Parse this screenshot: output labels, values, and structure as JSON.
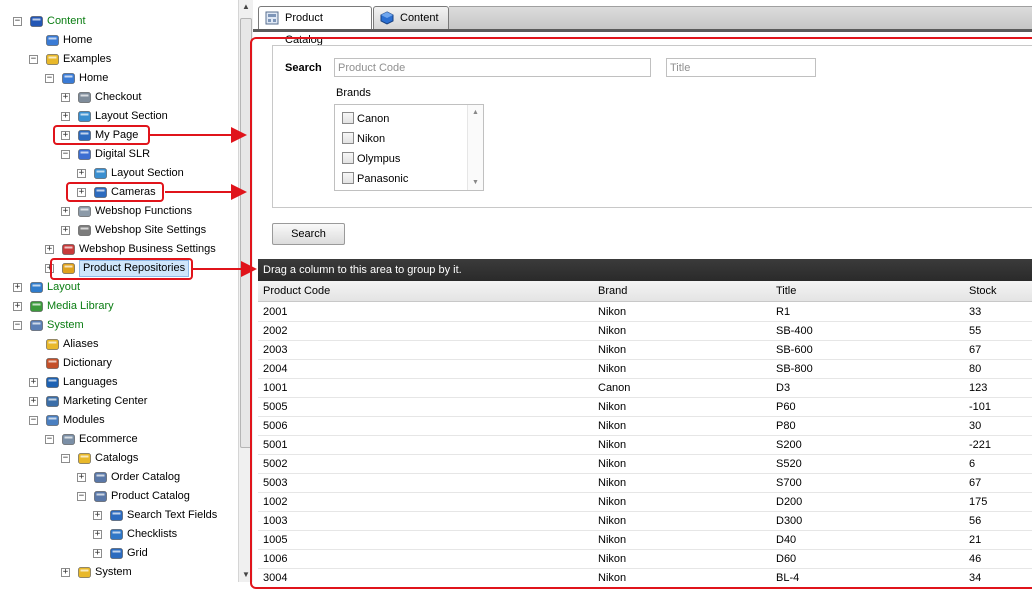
{
  "tree": {
    "nodes": [
      {
        "label": "Content",
        "icon": "content-icon",
        "expander": "minus",
        "color": "green"
      },
      {
        "label": "Home",
        "icon": "home-icon",
        "expander": ""
      },
      {
        "label": "Examples",
        "icon": "folder-icon",
        "expander": "minus"
      },
      {
        "label": "Home",
        "icon": "home-icon",
        "expander": "minus"
      },
      {
        "label": "Checkout",
        "icon": "page-icon",
        "expander": "plus"
      },
      {
        "label": "Layout Section",
        "icon": "layout-icon",
        "expander": "plus"
      },
      {
        "label": "My Page",
        "icon": "grid-icon",
        "expander": "plus"
      },
      {
        "label": "Digital SLR",
        "icon": "database-icon",
        "expander": "minus"
      },
      {
        "label": "Layout Section",
        "icon": "layout-icon",
        "expander": "plus"
      },
      {
        "label": "Cameras",
        "icon": "grid-icon",
        "expander": "plus"
      },
      {
        "label": "Webshop Functions",
        "icon": "document-icon",
        "expander": "plus"
      },
      {
        "label": "Webshop Site Settings",
        "icon": "settings-icon",
        "expander": "plus"
      },
      {
        "label": "Webshop Business Settings",
        "icon": "business-icon",
        "expander": "plus"
      },
      {
        "label": "Product Repositories",
        "icon": "box-icon",
        "expander": "plus"
      },
      {
        "label": "Layout",
        "icon": "layout-window-icon",
        "expander": "plus",
        "color": "green"
      },
      {
        "label": "Media Library",
        "icon": "image-icon",
        "expander": "plus",
        "color": "green"
      },
      {
        "label": "System",
        "icon": "system-icon",
        "expander": "minus",
        "color": "green"
      },
      {
        "label": "Aliases",
        "icon": "folder-icon",
        "expander": ""
      },
      {
        "label": "Dictionary",
        "icon": "dictionary-icon",
        "expander": ""
      },
      {
        "label": "Languages",
        "icon": "language-icon",
        "expander": "plus"
      },
      {
        "label": "Marketing Center",
        "icon": "marketing-icon",
        "expander": "plus"
      },
      {
        "label": "Modules",
        "icon": "modules-icon",
        "expander": "minus"
      },
      {
        "label": "Ecommerce",
        "icon": "ecommerce-icon",
        "expander": "minus"
      },
      {
        "label": "Catalogs",
        "icon": "folder-icon",
        "expander": "minus"
      },
      {
        "label": "Order Catalog",
        "icon": "catalog-icon",
        "expander": "plus"
      },
      {
        "label": "Product Catalog",
        "icon": "catalog-icon",
        "expander": "minus"
      },
      {
        "label": "Search Text Fields",
        "icon": "grid-icon",
        "expander": "plus"
      },
      {
        "label": "Checklists",
        "icon": "checklist-icon",
        "expander": "plus"
      },
      {
        "label": "Grid",
        "icon": "grid-icon",
        "expander": "plus"
      },
      {
        "label": "System",
        "icon": "folder-icon",
        "expander": "plus"
      }
    ]
  },
  "tabs": [
    {
      "label": "Product Catalog",
      "icon": "catalog-icon",
      "active": true
    },
    {
      "label": "Content",
      "icon": "cube-icon",
      "active": false
    }
  ],
  "search": {
    "label": "Search",
    "product_code_placeholder": "Product Code",
    "title_placeholder": "Title",
    "brands_label": "Brands",
    "brands": [
      "Canon",
      "Nikon",
      "Olympus",
      "Panasonic"
    ],
    "button_label": "Search"
  },
  "grid": {
    "group_hint": "Drag a column to this area to group by it.",
    "columns": [
      "Product Code",
      "Brand",
      "Title",
      "Stock"
    ],
    "rows": [
      [
        "2001",
        "Nikon",
        "R1",
        "33"
      ],
      [
        "2002",
        "Nikon",
        "SB-400",
        "55"
      ],
      [
        "2003",
        "Nikon",
        "SB-600",
        "67"
      ],
      [
        "2004",
        "Nikon",
        "SB-800",
        "80"
      ],
      [
        "1001",
        "Canon",
        "D3",
        "123"
      ],
      [
        "5005",
        "Nikon",
        "P60",
        "-101"
      ],
      [
        "5006",
        "Nikon",
        "P80",
        "30"
      ],
      [
        "5001",
        "Nikon",
        "S200",
        "-221"
      ],
      [
        "5002",
        "Nikon",
        "S520",
        "6"
      ],
      [
        "5003",
        "Nikon",
        "S700",
        "67"
      ],
      [
        "1002",
        "Nikon",
        "D200",
        "175"
      ],
      [
        "1003",
        "Nikon",
        "D300",
        "56"
      ],
      [
        "1005",
        "Nikon",
        "D40",
        "21"
      ],
      [
        "1006",
        "Nikon",
        "D60",
        "46"
      ],
      [
        "3004",
        "Nikon",
        "BL-4",
        "34"
      ]
    ]
  },
  "colors": {
    "highlight_red": "#e0141b",
    "tree_green": "#0a7d12",
    "group_bar": "#2f2f2f"
  }
}
